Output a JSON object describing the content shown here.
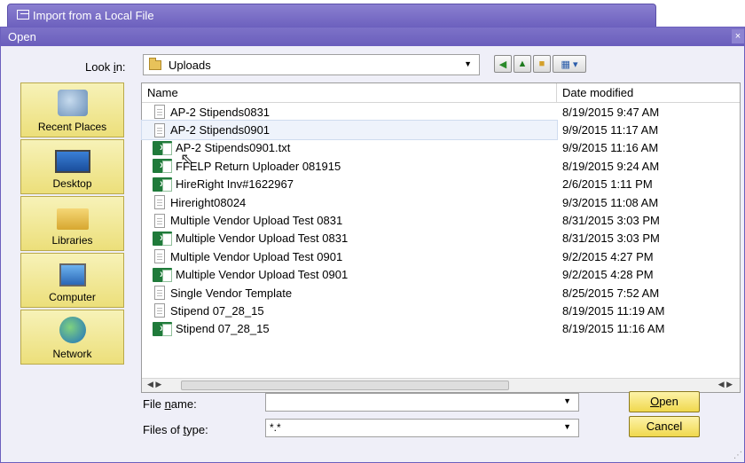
{
  "import_tab": {
    "title": "Import  from a Local File"
  },
  "dialog": {
    "title": "Open",
    "close_symbol": "×"
  },
  "look_in": {
    "label_pre": "Look ",
    "label_ul": "i",
    "label_post": "n:",
    "value": "Uploads"
  },
  "places": [
    {
      "label": "Recent Places",
      "icon": "recent-places-icon"
    },
    {
      "label": "Desktop",
      "icon": "desktop-icon"
    },
    {
      "label": "Libraries",
      "icon": "libraries-icon"
    },
    {
      "label": "Computer",
      "icon": "computer-icon"
    },
    {
      "label": "Network",
      "icon": "network-icon"
    }
  ],
  "columns": {
    "name": "Name",
    "date": "Date modified"
  },
  "files": [
    {
      "name": "AP-2 Stipends0831",
      "date": "8/19/2015 9:47 AM",
      "type": "txt"
    },
    {
      "name": "AP-2 Stipends0901",
      "date": "9/9/2015 11:17 AM",
      "type": "txt",
      "selected": true
    },
    {
      "name": "AP-2 Stipends0901.txt",
      "date": "9/9/2015 11:16 AM",
      "type": "xls"
    },
    {
      "name": "FFELP Return Uploader 081915",
      "date": "8/19/2015 9:24 AM",
      "type": "xls"
    },
    {
      "name": "HireRight Inv#1622967",
      "date": "2/6/2015 1:11 PM",
      "type": "xls"
    },
    {
      "name": "Hireright08024",
      "date": "9/3/2015 11:08 AM",
      "type": "txt"
    },
    {
      "name": "Multiple Vendor Upload Test 0831",
      "date": "8/31/2015 3:03 PM",
      "type": "txt"
    },
    {
      "name": "Multiple Vendor Upload Test 0831",
      "date": "8/31/2015 3:03 PM",
      "type": "xls"
    },
    {
      "name": "Multiple Vendor Upload Test 0901",
      "date": "9/2/2015 4:27 PM",
      "type": "txt"
    },
    {
      "name": "Multiple Vendor Upload Test 0901",
      "date": "9/2/2015 4:28 PM",
      "type": "xls"
    },
    {
      "name": "Single Vendor Template",
      "date": "8/25/2015 7:52 AM",
      "type": "txt"
    },
    {
      "name": "Stipend 07_28_15",
      "date": "8/19/2015 11:19 AM",
      "type": "txt"
    },
    {
      "name": "Stipend 07_28_15",
      "date": "8/19/2015 11:16 AM",
      "type": "xls"
    }
  ],
  "file_name": {
    "label_pre": "File ",
    "label_ul": "n",
    "label_post": "ame:",
    "value": ""
  },
  "files_of_type": {
    "label_pre": "Files of ",
    "label_ul": "t",
    "label_post": "ype:",
    "value": "*.*"
  },
  "buttons": {
    "open_ul": "O",
    "open_rest": "pen",
    "cancel": "Cancel"
  },
  "icons": {
    "xls_letter": "x"
  }
}
